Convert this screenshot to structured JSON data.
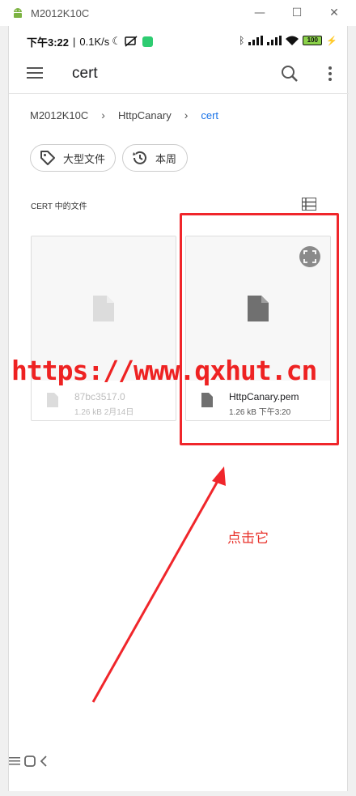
{
  "window": {
    "title": "M2012K10C",
    "minimize": "—",
    "maximize": "☐",
    "close": "✕"
  },
  "status_bar": {
    "time": "下午3:22",
    "speed": "0.1K/s",
    "battery": "100"
  },
  "app_bar": {
    "title": "cert"
  },
  "breadcrumb": {
    "items": [
      "M2012K10C",
      "HttpCanary",
      "cert"
    ]
  },
  "chips": [
    {
      "label": "大型文件",
      "icon": "tag-icon"
    },
    {
      "label": "本周",
      "icon": "history-icon"
    }
  ],
  "section": {
    "label": "CERT 中的文件"
  },
  "files": [
    {
      "name": "87bc3517.0",
      "meta": "1.26 kB 2月14日"
    },
    {
      "name": "HttpCanary.pem",
      "meta": "1.26 kB 下午3:20"
    }
  ],
  "annotation": {
    "watermark": "https://www.qxhut.cn",
    "hint": "点击它",
    "color": "#f0262b"
  },
  "colors": {
    "accent": "#1a73e8",
    "annotation": "#ee2222"
  }
}
